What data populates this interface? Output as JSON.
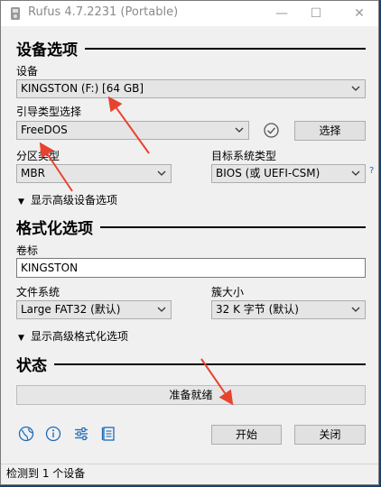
{
  "window": {
    "title": "Rufus 4.7.2231 (Portable)",
    "minimize": "—",
    "maximize": "☐",
    "close": "✕"
  },
  "drive_section": {
    "title": "设备选项",
    "device_label": "设备",
    "device_value": "KINGSTON (F:) [64 GB]",
    "boot_label": "引导类型选择",
    "boot_value": "FreeDOS",
    "select_button": "选择",
    "partition_label": "分区类型",
    "partition_value": "MBR",
    "target_label": "目标系统类型",
    "target_value": "BIOS (或 UEFI-CSM)",
    "target_help": "?",
    "advanced_toggle": "显示高级设备选项"
  },
  "format_section": {
    "title": "格式化选项",
    "volume_label": "卷标",
    "volume_value": "KINGSTON",
    "fs_label": "文件系统",
    "fs_value": "Large FAT32 (默认)",
    "cluster_label": "簇大小",
    "cluster_value": "32 K 字节 (默认)",
    "advanced_toggle": "显示高级格式化选项"
  },
  "status_section": {
    "title": "状态",
    "status_text": "准备就绪"
  },
  "actions": {
    "start": "开始",
    "close": "关闭"
  },
  "footer": {
    "text": "检测到 1 个设备"
  },
  "colors": {
    "accent": "#1c6bb7",
    "annotation_arrow": "#e8432e"
  }
}
